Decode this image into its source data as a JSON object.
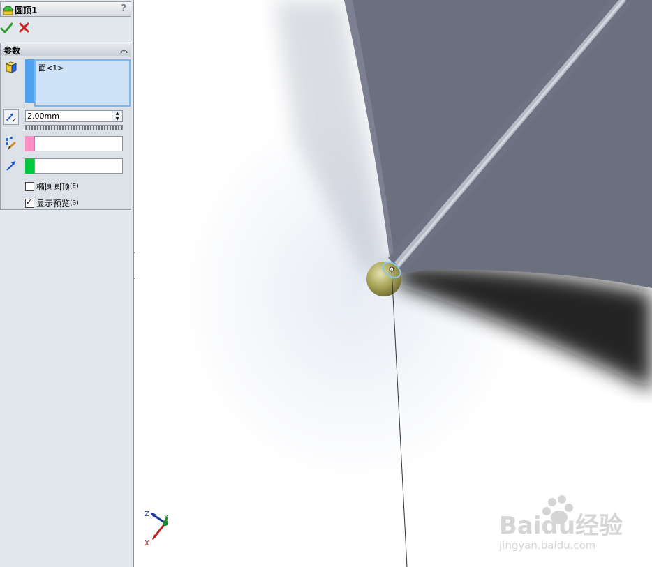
{
  "feature": {
    "title": "圆顶1",
    "help": "?"
  },
  "actions": {
    "ok_icon": "check-icon",
    "cancel_icon": "close-icon"
  },
  "params": {
    "group_title": "参数",
    "face_list_item": "面<1>",
    "radius_value": "2.00mm",
    "elliptical_label": "椭圆圆顶",
    "elliptical_hotkey": "(E)",
    "elliptical_checked": false,
    "preview_label": "显示预览",
    "preview_hotkey": "(S)",
    "preview_checked": true
  },
  "colors": {
    "face_swatch": "#4da3f0",
    "point_swatch": "#ff8ec7",
    "direction_swatch": "#00c83c",
    "model_body": "#6b6f7e",
    "dome": "#a8a458"
  },
  "triad": {
    "x_label": "X",
    "y_label": "Y",
    "z_label": "Z"
  },
  "watermark": {
    "logo": "Baidu经验",
    "url": "jingyan.baidu.com"
  }
}
